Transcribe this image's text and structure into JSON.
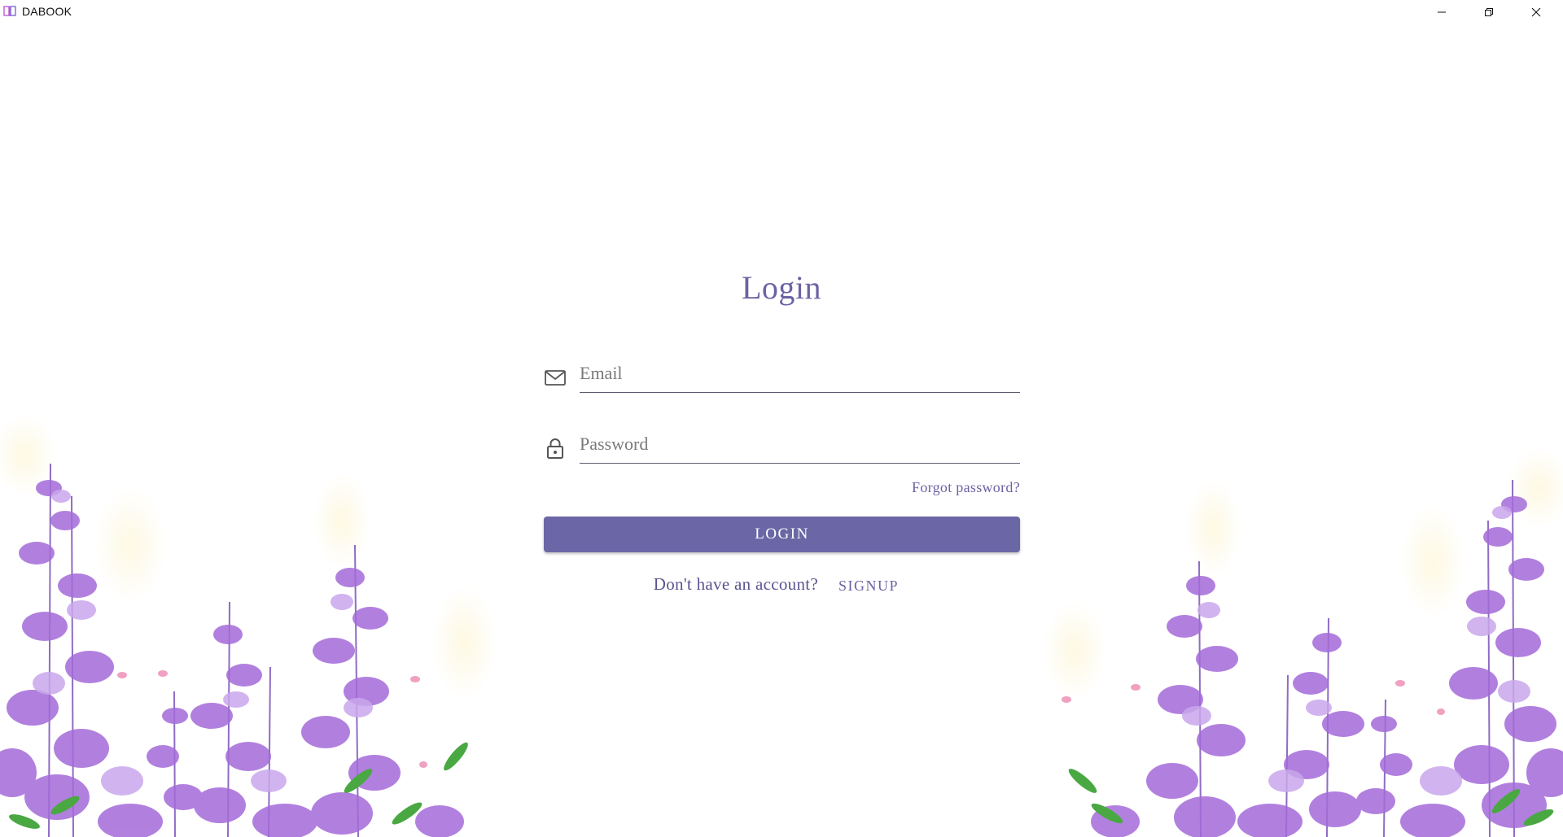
{
  "window": {
    "title": "DABOOK",
    "icons": {
      "app": "book-icon",
      "minimize": "minimize-icon",
      "maximize": "restore-icon",
      "close": "close-icon"
    }
  },
  "form": {
    "title": "Login",
    "email": {
      "placeholder": "Email",
      "value": "",
      "icon": "envelope-icon"
    },
    "password": {
      "placeholder": "Password",
      "value": "",
      "icon": "lock-icon"
    },
    "forgot_label": "Forgot password?",
    "login_label": "LOGIN",
    "signup_prompt": "Don't have an account?",
    "signup_label": "SIGNUP"
  },
  "colors": {
    "accent": "#6a63a3",
    "button": "#6b67a6",
    "flower_purple": "#a46bd9",
    "flower_light": "#c9a7ec",
    "leaf_green": "#4aa843"
  }
}
